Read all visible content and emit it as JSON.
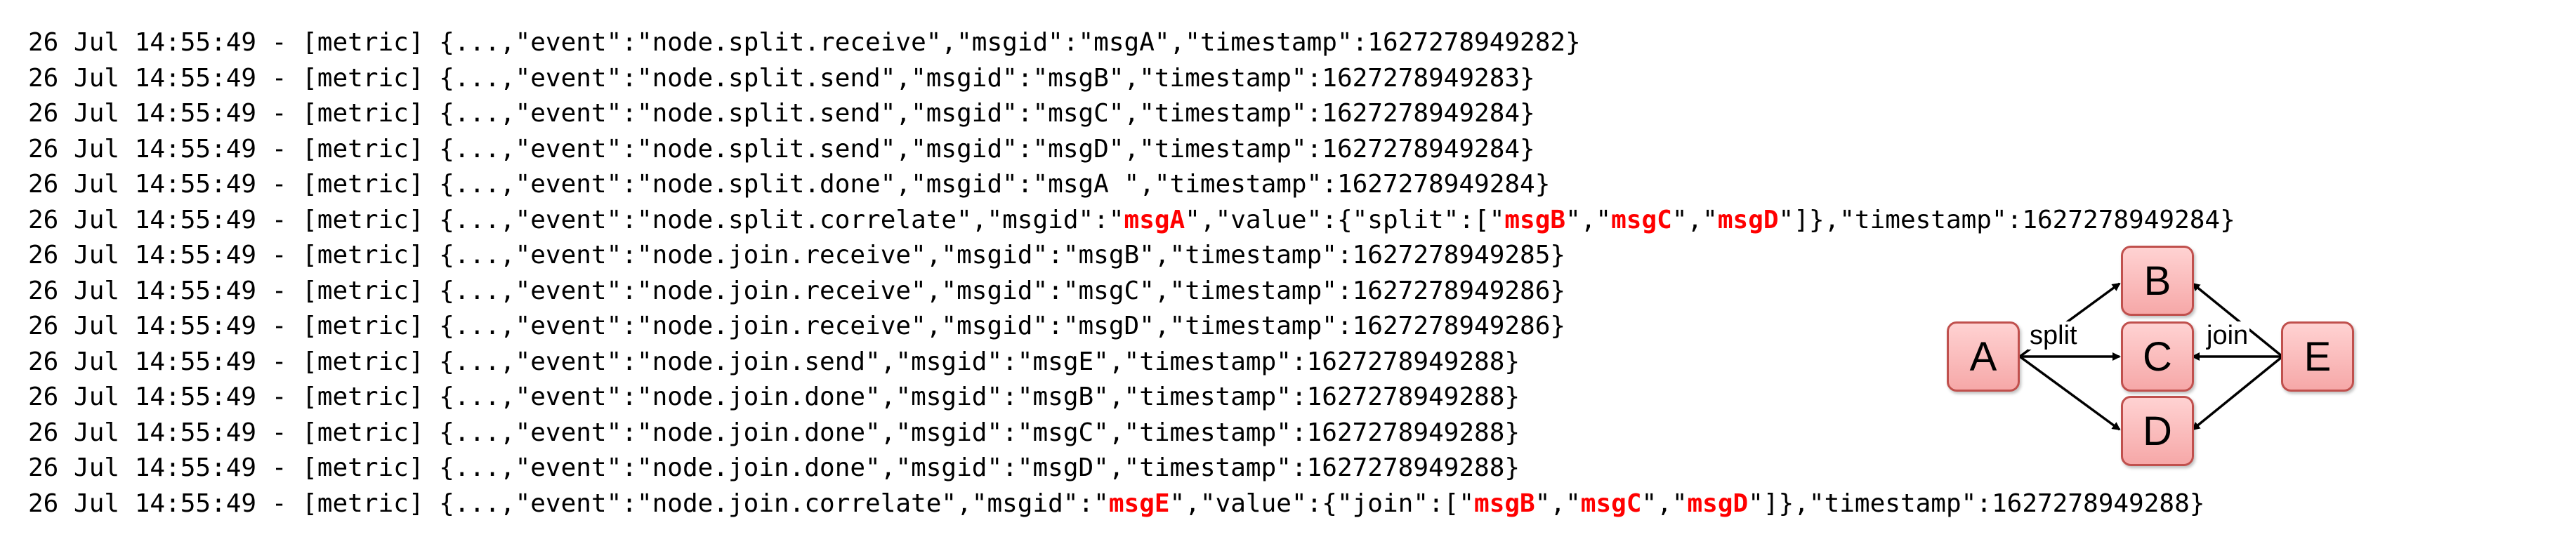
{
  "log": {
    "lines": [
      [
        {
          "t": "26 Jul 14:55:49 - [metric] {...,\"event\":\"node.split.receive\",\"msgid\":\"msgA\",\"timestamp\":1627278949282}"
        }
      ],
      [
        {
          "t": "26 Jul 14:55:49 - [metric] {...,\"event\":\"node.split.send\",\"msgid\":\"msgB\",\"timestamp\":1627278949283}"
        }
      ],
      [
        {
          "t": "26 Jul 14:55:49 - [metric] {...,\"event\":\"node.split.send\",\"msgid\":\"msgC\",\"timestamp\":1627278949284}"
        }
      ],
      [
        {
          "t": "26 Jul 14:55:49 - [metric] {...,\"event\":\"node.split.send\",\"msgid\":\"msgD\",\"timestamp\":1627278949284}"
        }
      ],
      [
        {
          "t": "26 Jul 14:55:49 - [metric] {...,\"event\":\"node.split.done\",\"msgid\":\"msgA \",\"timestamp\":1627278949284}"
        }
      ],
      [
        {
          "t": "26 Jul 14:55:49 - [metric] {...,\"event\":\"node.split.correlate\",\"msgid\":\""
        },
        {
          "t": "msgA",
          "hl": true
        },
        {
          "t": "\",\"value\":{\"split\":[\""
        },
        {
          "t": "msgB",
          "hl": true
        },
        {
          "t": "\",\""
        },
        {
          "t": "msgC",
          "hl": true
        },
        {
          "t": "\",\""
        },
        {
          "t": "msgD",
          "hl": true
        },
        {
          "t": "\"]},\"timestamp\":1627278949284}"
        }
      ],
      [
        {
          "t": "26 Jul 14:55:49 - [metric] {...,\"event\":\"node.join.receive\",\"msgid\":\"msgB\",\"timestamp\":1627278949285}"
        }
      ],
      [
        {
          "t": "26 Jul 14:55:49 - [metric] {...,\"event\":\"node.join.receive\",\"msgid\":\"msgC\",\"timestamp\":1627278949286}"
        }
      ],
      [
        {
          "t": "26 Jul 14:55:49 - [metric] {...,\"event\":\"node.join.receive\",\"msgid\":\"msgD\",\"timestamp\":1627278949286}"
        }
      ],
      [
        {
          "t": "26 Jul 14:55:49 - [metric] {...,\"event\":\"node.join.send\",\"msgid\":\"msgE\",\"timestamp\":1627278949288}"
        }
      ],
      [
        {
          "t": "26 Jul 14:55:49 - [metric] {...,\"event\":\"node.join.done\",\"msgid\":\"msgB\",\"timestamp\":1627278949288}"
        }
      ],
      [
        {
          "t": "26 Jul 14:55:49 - [metric] {...,\"event\":\"node.join.done\",\"msgid\":\"msgC\",\"timestamp\":1627278949288}"
        }
      ],
      [
        {
          "t": "26 Jul 14:55:49 - [metric] {...,\"event\":\"node.join.done\",\"msgid\":\"msgD\",\"timestamp\":1627278949288}"
        }
      ],
      [
        {
          "t": "26 Jul 14:55:49 - [metric] {...,\"event\":\"node.join.correlate\",\"msgid\":\""
        },
        {
          "t": "msgE",
          "hl": true
        },
        {
          "t": "\",\"value\":{\"join\":[\""
        },
        {
          "t": "msgB",
          "hl": true
        },
        {
          "t": "\",\""
        },
        {
          "t": "msgC",
          "hl": true
        },
        {
          "t": "\",\""
        },
        {
          "t": "msgD",
          "hl": true
        },
        {
          "t": "\"]},\"timestamp\":1627278949288}"
        }
      ]
    ]
  },
  "diagram": {
    "nodes": {
      "a": "A",
      "b": "B",
      "c": "C",
      "d": "D",
      "e": "E"
    },
    "labels": {
      "split": "split",
      "join": "join"
    }
  },
  "colors": {
    "highlight": "#ff0000",
    "node_fill": "#f6a8a8",
    "node_border": "#c0504d"
  }
}
